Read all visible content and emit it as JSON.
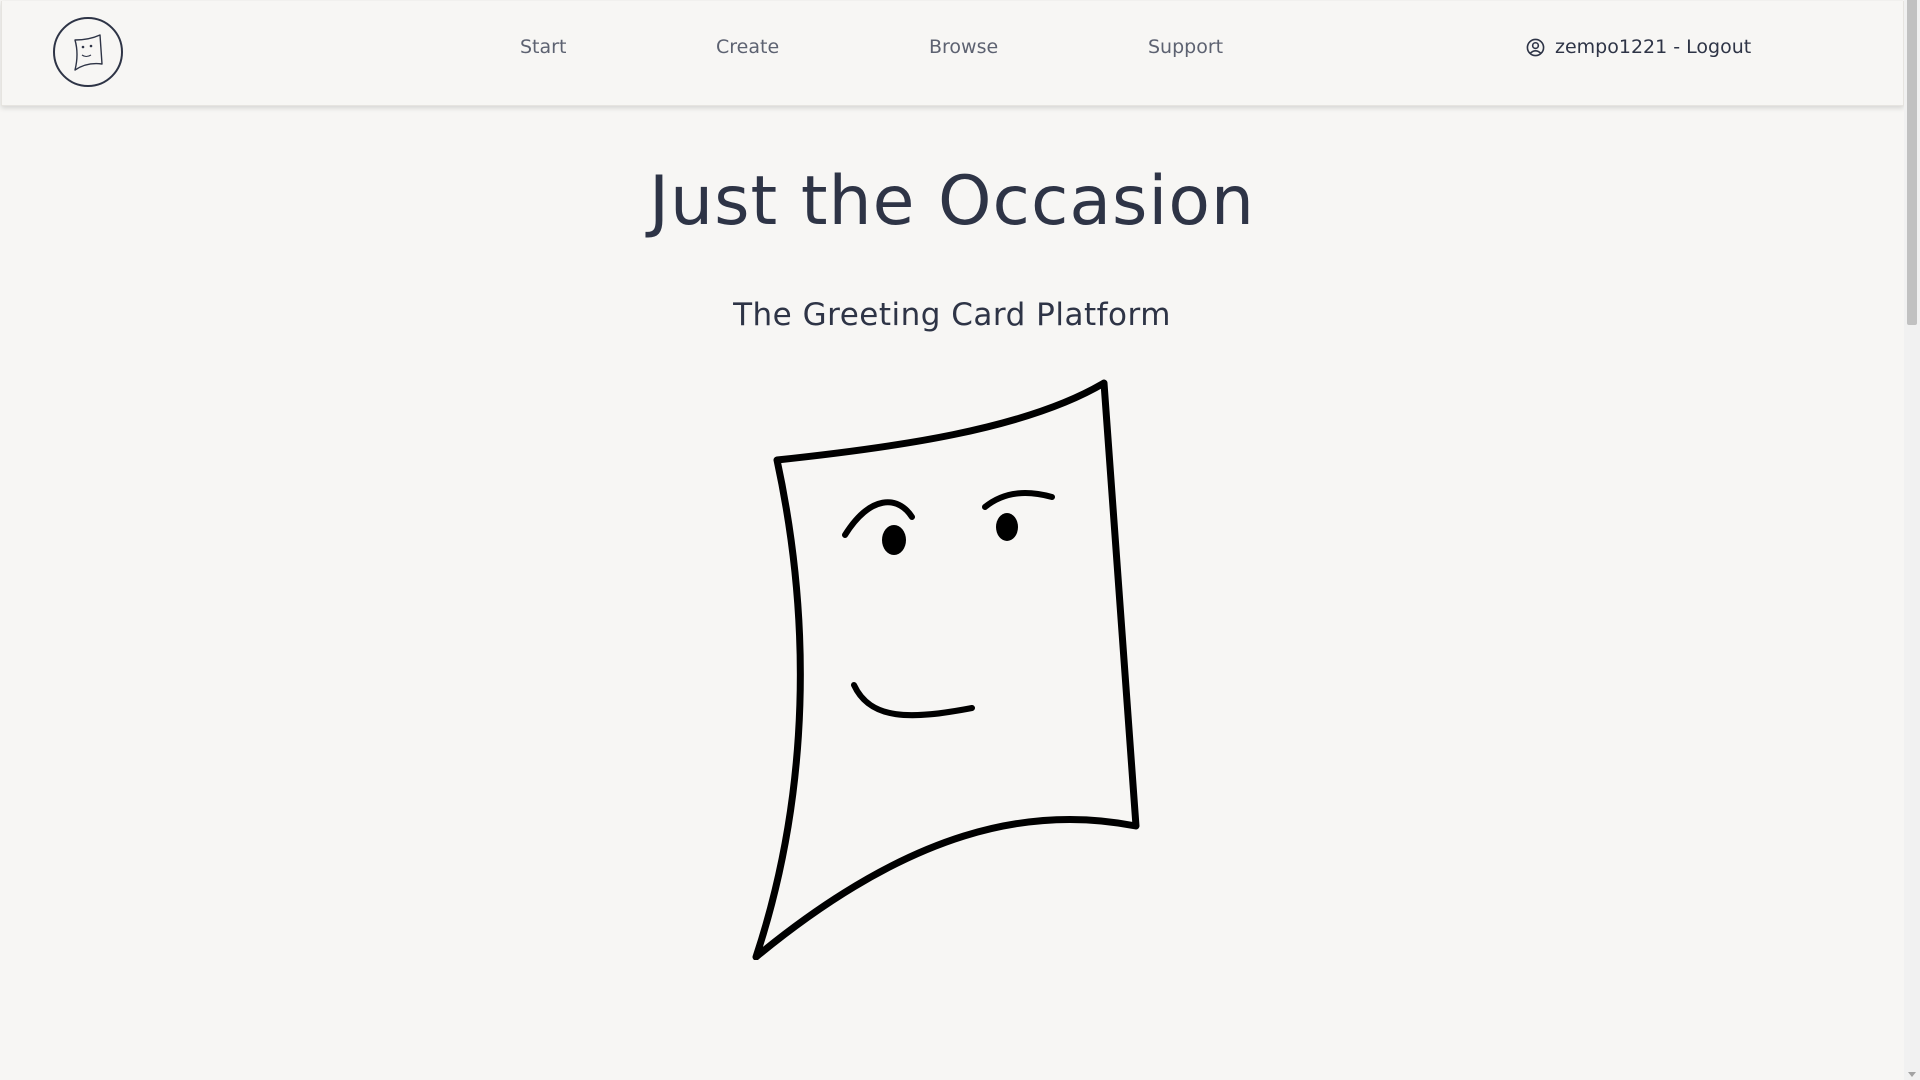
{
  "nav": {
    "start": "Start",
    "create": "Create",
    "browse": "Browse",
    "support": "Support",
    "user_label": "zempo1221 - Logout",
    "logo_icon": "card-face-logo-icon",
    "user_icon": "user-circle-icon"
  },
  "hero": {
    "title": "Just the Occasion",
    "subtitle": "The Greeting Card Platform",
    "illustration": "smiling-card-mascot-icon"
  },
  "colors": {
    "background": "#f7f6f4",
    "text": "#2e3446",
    "nav_link": "#5d6271"
  }
}
